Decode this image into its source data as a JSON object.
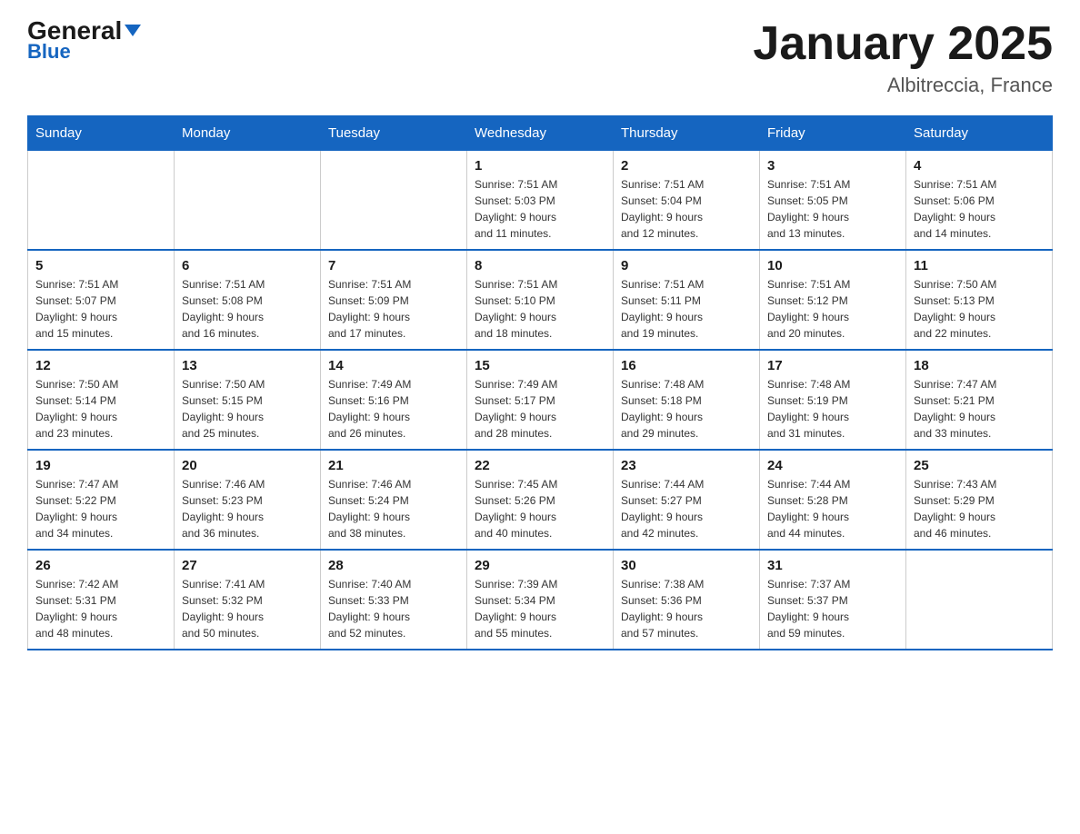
{
  "header": {
    "logo_general": "General",
    "logo_blue": "Blue",
    "title": "January 2025",
    "subtitle": "Albitreccia, France"
  },
  "days_of_week": [
    "Sunday",
    "Monday",
    "Tuesday",
    "Wednesday",
    "Thursday",
    "Friday",
    "Saturday"
  ],
  "weeks": [
    [
      {
        "day": "",
        "info": ""
      },
      {
        "day": "",
        "info": ""
      },
      {
        "day": "",
        "info": ""
      },
      {
        "day": "1",
        "info": "Sunrise: 7:51 AM\nSunset: 5:03 PM\nDaylight: 9 hours\nand 11 minutes."
      },
      {
        "day": "2",
        "info": "Sunrise: 7:51 AM\nSunset: 5:04 PM\nDaylight: 9 hours\nand 12 minutes."
      },
      {
        "day": "3",
        "info": "Sunrise: 7:51 AM\nSunset: 5:05 PM\nDaylight: 9 hours\nand 13 minutes."
      },
      {
        "day": "4",
        "info": "Sunrise: 7:51 AM\nSunset: 5:06 PM\nDaylight: 9 hours\nand 14 minutes."
      }
    ],
    [
      {
        "day": "5",
        "info": "Sunrise: 7:51 AM\nSunset: 5:07 PM\nDaylight: 9 hours\nand 15 minutes."
      },
      {
        "day": "6",
        "info": "Sunrise: 7:51 AM\nSunset: 5:08 PM\nDaylight: 9 hours\nand 16 minutes."
      },
      {
        "day": "7",
        "info": "Sunrise: 7:51 AM\nSunset: 5:09 PM\nDaylight: 9 hours\nand 17 minutes."
      },
      {
        "day": "8",
        "info": "Sunrise: 7:51 AM\nSunset: 5:10 PM\nDaylight: 9 hours\nand 18 minutes."
      },
      {
        "day": "9",
        "info": "Sunrise: 7:51 AM\nSunset: 5:11 PM\nDaylight: 9 hours\nand 19 minutes."
      },
      {
        "day": "10",
        "info": "Sunrise: 7:51 AM\nSunset: 5:12 PM\nDaylight: 9 hours\nand 20 minutes."
      },
      {
        "day": "11",
        "info": "Sunrise: 7:50 AM\nSunset: 5:13 PM\nDaylight: 9 hours\nand 22 minutes."
      }
    ],
    [
      {
        "day": "12",
        "info": "Sunrise: 7:50 AM\nSunset: 5:14 PM\nDaylight: 9 hours\nand 23 minutes."
      },
      {
        "day": "13",
        "info": "Sunrise: 7:50 AM\nSunset: 5:15 PM\nDaylight: 9 hours\nand 25 minutes."
      },
      {
        "day": "14",
        "info": "Sunrise: 7:49 AM\nSunset: 5:16 PM\nDaylight: 9 hours\nand 26 minutes."
      },
      {
        "day": "15",
        "info": "Sunrise: 7:49 AM\nSunset: 5:17 PM\nDaylight: 9 hours\nand 28 minutes."
      },
      {
        "day": "16",
        "info": "Sunrise: 7:48 AM\nSunset: 5:18 PM\nDaylight: 9 hours\nand 29 minutes."
      },
      {
        "day": "17",
        "info": "Sunrise: 7:48 AM\nSunset: 5:19 PM\nDaylight: 9 hours\nand 31 minutes."
      },
      {
        "day": "18",
        "info": "Sunrise: 7:47 AM\nSunset: 5:21 PM\nDaylight: 9 hours\nand 33 minutes."
      }
    ],
    [
      {
        "day": "19",
        "info": "Sunrise: 7:47 AM\nSunset: 5:22 PM\nDaylight: 9 hours\nand 34 minutes."
      },
      {
        "day": "20",
        "info": "Sunrise: 7:46 AM\nSunset: 5:23 PM\nDaylight: 9 hours\nand 36 minutes."
      },
      {
        "day": "21",
        "info": "Sunrise: 7:46 AM\nSunset: 5:24 PM\nDaylight: 9 hours\nand 38 minutes."
      },
      {
        "day": "22",
        "info": "Sunrise: 7:45 AM\nSunset: 5:26 PM\nDaylight: 9 hours\nand 40 minutes."
      },
      {
        "day": "23",
        "info": "Sunrise: 7:44 AM\nSunset: 5:27 PM\nDaylight: 9 hours\nand 42 minutes."
      },
      {
        "day": "24",
        "info": "Sunrise: 7:44 AM\nSunset: 5:28 PM\nDaylight: 9 hours\nand 44 minutes."
      },
      {
        "day": "25",
        "info": "Sunrise: 7:43 AM\nSunset: 5:29 PM\nDaylight: 9 hours\nand 46 minutes."
      }
    ],
    [
      {
        "day": "26",
        "info": "Sunrise: 7:42 AM\nSunset: 5:31 PM\nDaylight: 9 hours\nand 48 minutes."
      },
      {
        "day": "27",
        "info": "Sunrise: 7:41 AM\nSunset: 5:32 PM\nDaylight: 9 hours\nand 50 minutes."
      },
      {
        "day": "28",
        "info": "Sunrise: 7:40 AM\nSunset: 5:33 PM\nDaylight: 9 hours\nand 52 minutes."
      },
      {
        "day": "29",
        "info": "Sunrise: 7:39 AM\nSunset: 5:34 PM\nDaylight: 9 hours\nand 55 minutes."
      },
      {
        "day": "30",
        "info": "Sunrise: 7:38 AM\nSunset: 5:36 PM\nDaylight: 9 hours\nand 57 minutes."
      },
      {
        "day": "31",
        "info": "Sunrise: 7:37 AM\nSunset: 5:37 PM\nDaylight: 9 hours\nand 59 minutes."
      },
      {
        "day": "",
        "info": ""
      }
    ]
  ]
}
